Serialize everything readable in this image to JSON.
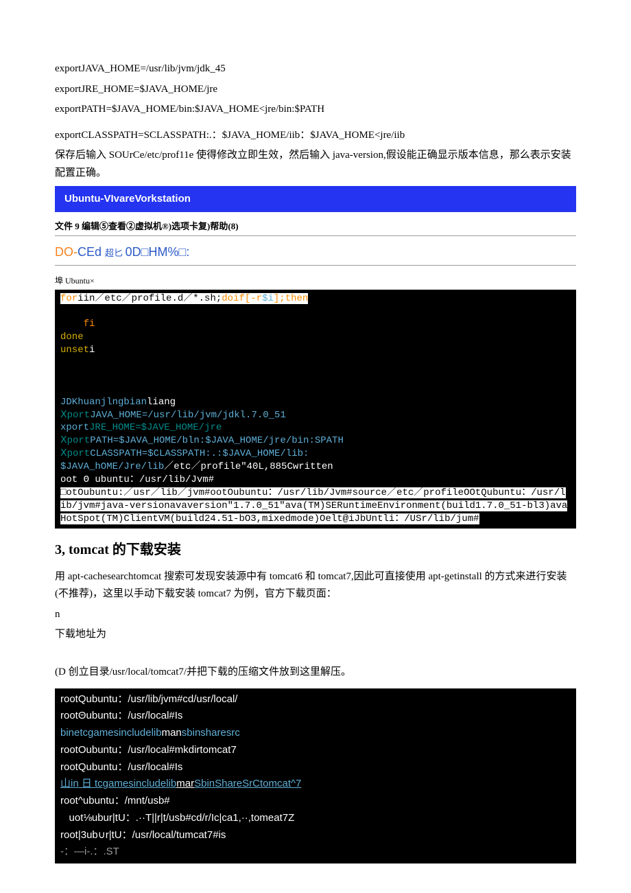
{
  "env_lines": {
    "java_home": "exportJAVA_HOME=/usr/lib/jvm/jdk_45",
    "jre_home": "exportJRE_HOME=$JAVA_HOME/jre",
    "path": "exportPATH=$JAVA_HOME/bin:$JAVA_HOME<jre/bin:$PATH",
    "classpath": "exportCLASSPATH=SCLASSPATH:.：$JAVA_HOME/iib：$JAVA_HOME<jre/iib",
    "note": "保存后输入 SOUrCe/etc/prof11e 使得修改立即生效，然后输入 java-version,假设能正确显示版本信息，那么表示安装配置正确。"
  },
  "window": {
    "title": "Ubuntu-VIvareVorkstation",
    "menu": "文件 9 编辑⑤查看②虚拟机®)选项卡复)帮助(8)",
    "toolbar_a": "DO-",
    "toolbar_b": "CEd ",
    "toolbar_c": "超匕 ",
    "toolbar_d": "0D□HM%□:",
    "tab": "埠 Ubuntu×"
  },
  "term1": {
    "l1a": "for",
    "l1b": "iin",
    "l1c": "／etc／profile.d／*.sh;",
    "l1d": "do",
    "l1e": "if[-r",
    "l1f": "$i",
    "l1g": "];then",
    "fi": "fi",
    "done": "done",
    "unset": "unset",
    "unset_i": "i",
    "jdk_label": "JDKhuanjlngbian",
    "jdk_label2": "liang",
    "x1a": "Ⅹport",
    "x1b": "JAVA_HOME=/usr/lib/jvm/jdkl.7.0_51",
    "x2a": "xport",
    "x2b": "JRE_HOME=$JAVE_HOME/jre",
    "x3a": "Ⅹport",
    "x3b": "PATH=$JAVA_HOME/bln:$JAVA_HOME/jre/bin:SPATH",
    "x4a": "Ⅹport",
    "x4b": "CLASSPATH=$CLASSPATH:.:$JAVA_HOME/lib:",
    "p5a": "$JAVA_hOME/Jre/lib",
    "p5b": "／etc／profile\"40L,885Cwritten",
    "p6": "oot Θ ubuntu：/usr/lib/Jvm#",
    "p7a": "□otOubuntu:／usr／lib／jvm#ootOubuntu：/usr/lib/Jvm#source／etc／profileOOtQubuntu：/usr/lib/jvm#java-versionavaversion\"1.7.0_51\"ava(TM)SERuntimeEnvironment(build1.7.0_51-bl3)avaHotSpot(TM)ClientVM(build24.51-bO3,mixedmode)Oelt@iJbUntli：/USr/lib/jum#"
  },
  "section": {
    "title": "3,   tomcat 的下载安装",
    "p1": "用 apt-cachesearchtomcat 搜索可发现安装源中有 tomcat6 和 tomcat7,因此可直接使用 apt-getinstall 的方式来进行安装(不推荐)，这里以手动下载安装 tomcat7 为例，官方下载页面：",
    "p2": "n",
    "p3": "下载地址为",
    "p4": "(D 创立目录/usr/local/tomcat7/并把下载的压缩文件放到这里解压。"
  },
  "term2": {
    "l1": "rootQubuntu：/usr/lib/jvm#cd/usr/local/",
    "l2": "rootΘubuntu：/usr/local#Is",
    "l3a": "binetcgamesincludelib",
    "l3b": "man",
    "l3c": "sbinsharesrc",
    "l4": "rootOubuntu：/usr/local#mkdirtomcat7",
    "l5": "rootQubuntu：/usr/local#Is",
    "l6a": "山in 日 tcgamesincludelib",
    "l6b": "mar",
    "l6c": "SbinShareSrCtomcat^7",
    "l7": "root^ubuntu：/mnt/usb#",
    "l8": "   uot⅛ubur|tU：.··T||r|t/usb#cd/r/Ic|ca1,··,tomeat7Z",
    "l9": "root|3ub∪r|tU：/usr/local/tumcat7#is",
    "l10": "-：—i-.：.ST"
  }
}
